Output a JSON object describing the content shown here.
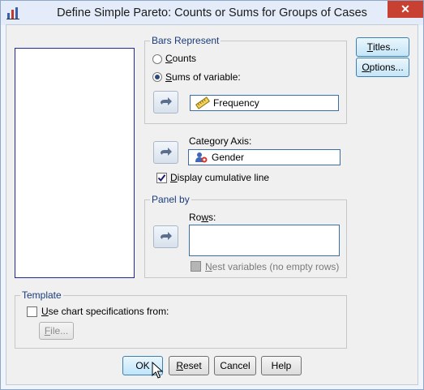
{
  "window": {
    "title": "Define Simple Pareto: Counts or Sums for Groups of Cases",
    "close_glyph": "✕"
  },
  "bars_represent": {
    "legend": "Bars Represent",
    "counts_label": "Counts",
    "counts_key": "C",
    "counts_rest": "ounts",
    "sums_key": "S",
    "sums_rest": "ums of variable:",
    "selected": "sums",
    "variable": "Frequency"
  },
  "category_axis": {
    "label": "Category Axis:",
    "value": "Gender"
  },
  "cumulative": {
    "key": "D",
    "rest": "isplay cumulative line",
    "checked": true
  },
  "panel_by": {
    "legend": "Panel by",
    "rows_key": "w",
    "rows_pre": "Ro",
    "rows_post": "s:",
    "nest_key": "N",
    "nest_rest": "est variables (no empty rows)"
  },
  "template": {
    "legend": "Template",
    "use_key": "U",
    "use_rest": "se chart specifications from:",
    "file_key": "F",
    "file_rest": "ile..."
  },
  "side_buttons": {
    "titles_key": "T",
    "titles_rest": "itles...",
    "options_key": "O",
    "options_rest": "ptions..."
  },
  "bottom_buttons": {
    "ok": "OK",
    "reset_key": "R",
    "reset_rest": "eset",
    "cancel": "Cancel",
    "help": "Help"
  },
  "colors": {
    "accent": "#3c7fb1",
    "close": "#c84031",
    "list_border": "#1e2a9a"
  }
}
